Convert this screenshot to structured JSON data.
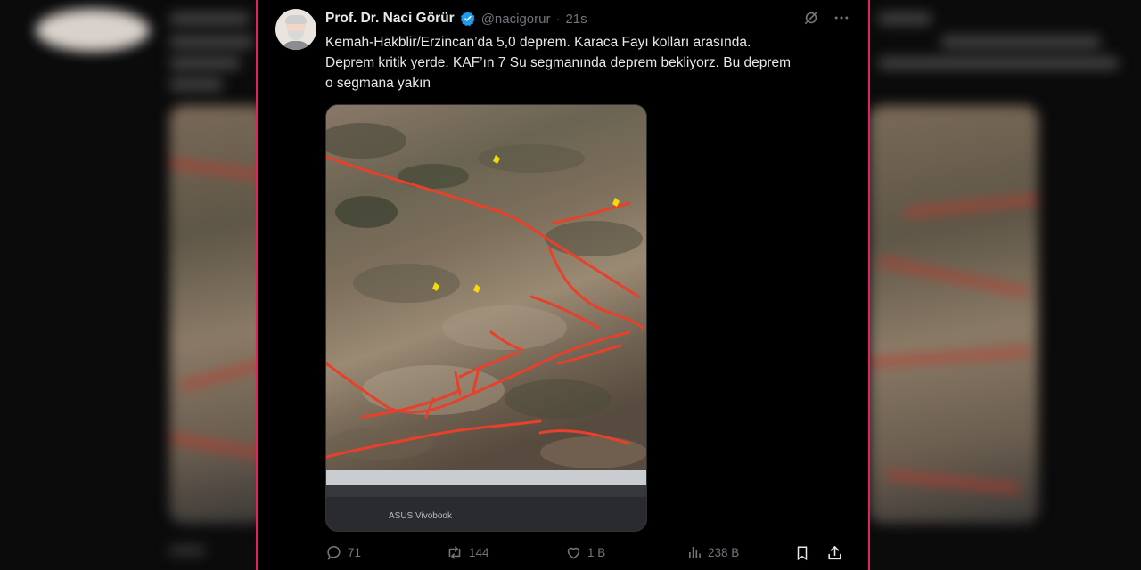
{
  "tweet": {
    "author_name": "Prof. Dr. Naci Görür",
    "handle": "@nacigorur",
    "separator": "·",
    "time": "21s",
    "text_lines": [
      "Kemah-Hakblir/Erzincan’da 5,0 deprem. Karaca Fayı kolları arasında.",
      "Deprem kritik yerde. KAF’ın 7 Su segmanında deprem bekliyorz. Bu deprem",
      "o segmana yakın"
    ],
    "media": {
      "laptop_brand": "ASUS Vivobook"
    }
  },
  "actions": {
    "replies": "71",
    "reposts": "144",
    "likes": "1 B",
    "views": "238 B"
  },
  "icons": {
    "verified": "verified-badge-icon",
    "grok": "grok-icon",
    "more": "more-icon",
    "reply": "reply-icon",
    "repost": "repost-icon",
    "like": "heart-icon",
    "views": "views-chart-icon",
    "bookmark": "bookmark-icon",
    "share": "share-icon"
  },
  "colors": {
    "verified": "#1d9bf0",
    "fault_lines": "#e8402a",
    "marker": "#f5d90a",
    "muted": "#71767b",
    "card_border": "#e0245e"
  }
}
